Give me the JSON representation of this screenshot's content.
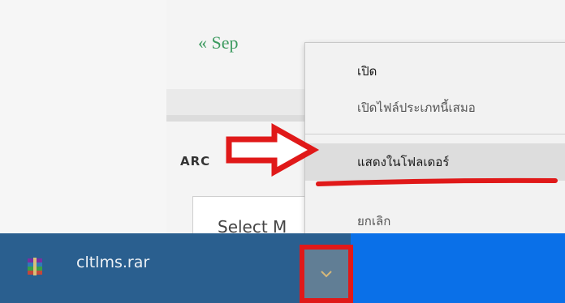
{
  "page": {
    "heading_fragment": "",
    "prev_link": "« Sep",
    "archive_title": "ARC",
    "select_text": "Select M"
  },
  "context_menu": {
    "items": [
      {
        "label": "เปิด"
      },
      {
        "label": "เปิดไฟล์ประเภทนี้เสมอ"
      },
      {
        "label": "แสดงในโฟลเดอร์"
      },
      {
        "label": "ยกเลิก"
      }
    ]
  },
  "download_bar": {
    "file_name": "cltlms.rar",
    "file_icon": "winrar-archive-icon",
    "options_icon": "chevron-down-icon"
  },
  "colors": {
    "annotation": "#e01919",
    "download_bar": "#2a5f8f",
    "accent_blue": "#0a70e8",
    "link": "#3c9a5f"
  }
}
